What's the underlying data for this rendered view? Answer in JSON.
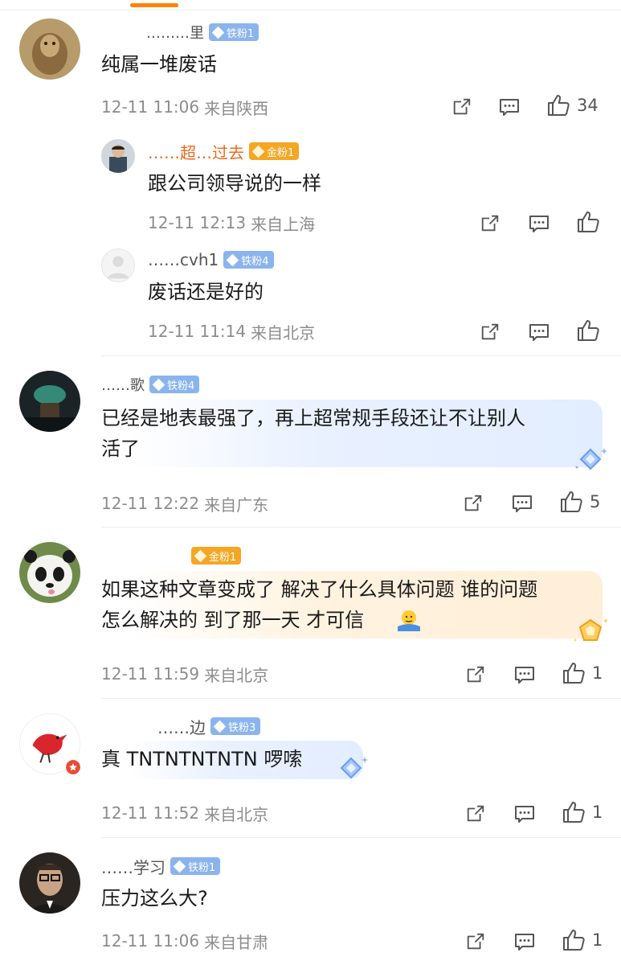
{
  "comments": [
    {
      "username": "………里",
      "badge": "铁粉1",
      "text": "纯属一堆废话",
      "time": "12-11 11:06",
      "location": "来自陕西",
      "likes": "34",
      "replies": [
        {
          "username": "……超…过去",
          "badge": "金粉1",
          "text": "跟公司领导说的一样",
          "time": "12-11 12:13",
          "location": "来自上海"
        },
        {
          "username": "……cvh1",
          "badge": "铁粉4",
          "text": "废话还是好的",
          "time": "12-11 11:14",
          "location": "来自北京"
        }
      ]
    },
    {
      "username": "……歌",
      "badge": "铁粉4",
      "text_line1": "已经是地表最强了，再上超常规手段还让不让别人",
      "text_line2": "活了",
      "time": "12-11 12:22",
      "location": "来自广东",
      "likes": "5"
    },
    {
      "badge": "金粉1",
      "text_line1": "如果这种文章变成了 解决了什么具体问题 谁的问题",
      "text_line2": "怎么解决的 到了那一天 才可信",
      "time": "12-11 11:59",
      "location": "来自北京",
      "likes": "1"
    },
    {
      "username": "……边",
      "badge": "铁粉3",
      "text": "真 TNTNTNTNTN 啰嗦",
      "time": "12-11 11:52",
      "location": "来自北京",
      "likes": "1"
    },
    {
      "username": "……学习",
      "badge": "铁粉1",
      "text": "压力这么大?",
      "time": "12-11 11:06",
      "location": "来自甘肃",
      "likes": "1"
    }
  ],
  "colors": {
    "accent": "#ff8200",
    "iron_badge": "#8ab4ee",
    "gold_badge": "#f5a623",
    "meta_text": "#8c8c8c"
  },
  "icons": [
    "share-icon",
    "comment-icon",
    "like-icon",
    "gem-icon",
    "emoji-shrug-icon"
  ]
}
